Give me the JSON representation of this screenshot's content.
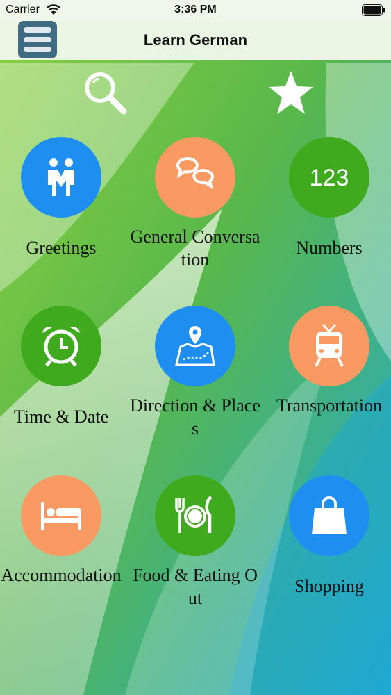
{
  "status_bar": {
    "carrier": "Carrier",
    "time": "3:36 PM"
  },
  "nav": {
    "title": "Learn German",
    "menu_icon": "hamburger-menu-icon"
  },
  "toolbar": {
    "search_icon": "magnifier-icon",
    "favorite_icon": "star-icon"
  },
  "colors": {
    "blue": "#1e8ff0",
    "orange": "#f99a62",
    "green": "#3faa1e",
    "nav_button": "#3f6b83"
  },
  "categories": [
    {
      "label": "Greetings",
      "color": "blue",
      "icon": "handshake-people-icon"
    },
    {
      "label": "General Conversation",
      "color": "orange",
      "icon": "chat-bubbles-icon"
    },
    {
      "label": "Numbers",
      "color": "green",
      "icon": "numbers-123-icon"
    },
    {
      "label": "Time & Date",
      "color": "green",
      "icon": "alarm-clock-icon"
    },
    {
      "label": "Direction & Places",
      "color": "blue",
      "icon": "map-pin-icon"
    },
    {
      "label": "Transportation",
      "color": "orange",
      "icon": "train-icon"
    },
    {
      "label": "Accommodation",
      "color": "orange",
      "icon": "bed-icon"
    },
    {
      "label": "Food & Eating Out",
      "color": "green",
      "icon": "fork-plate-knife-icon"
    },
    {
      "label": "Shopping",
      "color": "blue",
      "icon": "shopping-bag-icon"
    }
  ]
}
